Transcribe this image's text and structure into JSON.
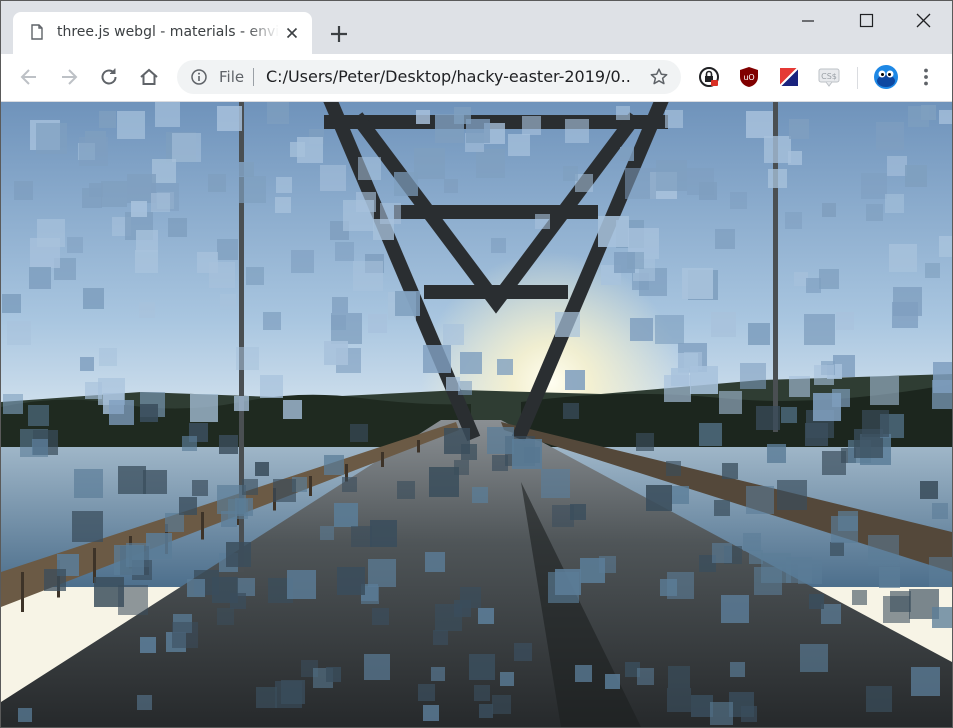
{
  "tab": {
    "title": "three.js webgl - materials - environment"
  },
  "omnibox": {
    "scheme_label": "File",
    "url": "C:/Users/Peter/Desktop/hacky-easter-2019/0..."
  },
  "extensions": {
    "css_badge_text": "CS$",
    "ublock_text": "uO"
  }
}
